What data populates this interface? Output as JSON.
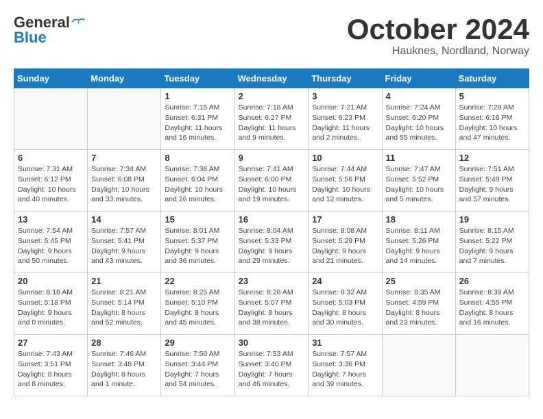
{
  "header": {
    "logo_line1": "General",
    "logo_line2": "Blue",
    "month": "October 2024",
    "location": "Hauknes, Nordland, Norway"
  },
  "weekdays": [
    "Sunday",
    "Monday",
    "Tuesday",
    "Wednesday",
    "Thursday",
    "Friday",
    "Saturday"
  ],
  "weeks": [
    [
      {
        "day": "",
        "info": ""
      },
      {
        "day": "",
        "info": ""
      },
      {
        "day": "1",
        "info": "Sunrise: 7:15 AM\nSunset: 6:31 PM\nDaylight: 11 hours\nand 16 minutes."
      },
      {
        "day": "2",
        "info": "Sunrise: 7:18 AM\nSunset: 6:27 PM\nDaylight: 11 hours\nand 9 minutes."
      },
      {
        "day": "3",
        "info": "Sunrise: 7:21 AM\nSunset: 6:23 PM\nDaylight: 11 hours\nand 2 minutes."
      },
      {
        "day": "4",
        "info": "Sunrise: 7:24 AM\nSunset: 6:20 PM\nDaylight: 10 hours\nand 55 minutes."
      },
      {
        "day": "5",
        "info": "Sunrise: 7:28 AM\nSunset: 6:16 PM\nDaylight: 10 hours\nand 47 minutes."
      }
    ],
    [
      {
        "day": "6",
        "info": "Sunrise: 7:31 AM\nSunset: 6:12 PM\nDaylight: 10 hours\nand 40 minutes."
      },
      {
        "day": "7",
        "info": "Sunrise: 7:34 AM\nSunset: 6:08 PM\nDaylight: 10 hours\nand 33 minutes."
      },
      {
        "day": "8",
        "info": "Sunrise: 7:38 AM\nSunset: 6:04 PM\nDaylight: 10 hours\nand 26 minutes."
      },
      {
        "day": "9",
        "info": "Sunrise: 7:41 AM\nSunset: 6:00 PM\nDaylight: 10 hours\nand 19 minutes."
      },
      {
        "day": "10",
        "info": "Sunrise: 7:44 AM\nSunset: 5:56 PM\nDaylight: 10 hours\nand 12 minutes."
      },
      {
        "day": "11",
        "info": "Sunrise: 7:47 AM\nSunset: 5:52 PM\nDaylight: 10 hours\nand 5 minutes."
      },
      {
        "day": "12",
        "info": "Sunrise: 7:51 AM\nSunset: 5:49 PM\nDaylight: 9 hours\nand 57 minutes."
      }
    ],
    [
      {
        "day": "13",
        "info": "Sunrise: 7:54 AM\nSunset: 5:45 PM\nDaylight: 9 hours\nand 50 minutes."
      },
      {
        "day": "14",
        "info": "Sunrise: 7:57 AM\nSunset: 5:41 PM\nDaylight: 9 hours\nand 43 minutes."
      },
      {
        "day": "15",
        "info": "Sunrise: 8:01 AM\nSunset: 5:37 PM\nDaylight: 9 hours\nand 36 minutes."
      },
      {
        "day": "16",
        "info": "Sunrise: 8:04 AM\nSunset: 5:33 PM\nDaylight: 9 hours\nand 29 minutes."
      },
      {
        "day": "17",
        "info": "Sunrise: 8:08 AM\nSunset: 5:29 PM\nDaylight: 9 hours\nand 21 minutes."
      },
      {
        "day": "18",
        "info": "Sunrise: 8:11 AM\nSunset: 5:26 PM\nDaylight: 9 hours\nand 14 minutes."
      },
      {
        "day": "19",
        "info": "Sunrise: 8:15 AM\nSunset: 5:22 PM\nDaylight: 9 hours\nand 7 minutes."
      }
    ],
    [
      {
        "day": "20",
        "info": "Sunrise: 8:18 AM\nSunset: 5:18 PM\nDaylight: 9 hours\nand 0 minutes."
      },
      {
        "day": "21",
        "info": "Sunrise: 8:21 AM\nSunset: 5:14 PM\nDaylight: 8 hours\nand 52 minutes."
      },
      {
        "day": "22",
        "info": "Sunrise: 8:25 AM\nSunset: 5:10 PM\nDaylight: 8 hours\nand 45 minutes."
      },
      {
        "day": "23",
        "info": "Sunrise: 8:28 AM\nSunset: 5:07 PM\nDaylight: 8 hours\nand 38 minutes."
      },
      {
        "day": "24",
        "info": "Sunrise: 8:32 AM\nSunset: 5:03 PM\nDaylight: 8 hours\nand 30 minutes."
      },
      {
        "day": "25",
        "info": "Sunrise: 8:35 AM\nSunset: 4:59 PM\nDaylight: 8 hours\nand 23 minutes."
      },
      {
        "day": "26",
        "info": "Sunrise: 8:39 AM\nSunset: 4:55 PM\nDaylight: 8 hours\nand 16 minutes."
      }
    ],
    [
      {
        "day": "27",
        "info": "Sunrise: 7:43 AM\nSunset: 3:51 PM\nDaylight: 8 hours\nand 8 minutes."
      },
      {
        "day": "28",
        "info": "Sunrise: 7:46 AM\nSunset: 3:48 PM\nDaylight: 8 hours\nand 1 minute."
      },
      {
        "day": "29",
        "info": "Sunrise: 7:50 AM\nSunset: 3:44 PM\nDaylight: 7 hours\nand 54 minutes."
      },
      {
        "day": "30",
        "info": "Sunrise: 7:53 AM\nSunset: 3:40 PM\nDaylight: 7 hours\nand 46 minutes."
      },
      {
        "day": "31",
        "info": "Sunrise: 7:57 AM\nSunset: 3:36 PM\nDaylight: 7 hours\nand 39 minutes."
      },
      {
        "day": "",
        "info": ""
      },
      {
        "day": "",
        "info": ""
      }
    ]
  ]
}
